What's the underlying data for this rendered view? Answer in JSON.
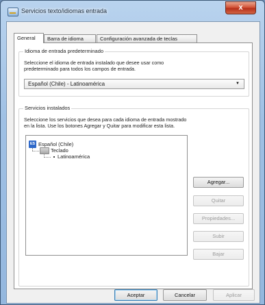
{
  "window": {
    "title": "Servicios texto/idiomas entrada",
    "close_symbol": "x"
  },
  "tabs": [
    {
      "label": "General",
      "active": true
    },
    {
      "label": "Barra de idioma",
      "active": false
    },
    {
      "label": "Configuración avanzada de teclas",
      "active": false
    }
  ],
  "default_language": {
    "group_label": "Idioma de entrada predeterminado",
    "description_line1": "Seleccione el idioma de entrada instalado que desee usar como",
    "description_line2": "predeterminado para todos los campos de entrada.",
    "selected_value": "Español (Chile) - Latinoamérica",
    "dropdown_symbol": "▼"
  },
  "installed_services": {
    "group_label": "Servicios instalados",
    "description_line1": "Seleccione los servicios que desea para cada idioma de entrada mostrado",
    "description_line2": "en la lista. Use los botones Agregar y Quitar para modificar esta lista.",
    "tree": {
      "language_badge": "ES",
      "language": "Español (Chile)",
      "category": "Teclado",
      "layout": "Latinoamérica"
    },
    "buttons": {
      "add": "Agregar...",
      "remove": "Quitar",
      "properties": "Propiedades...",
      "move_up": "Subir",
      "move_down": "Bajar"
    }
  },
  "footer": {
    "ok": "Aceptar",
    "cancel": "Cancelar",
    "apply": "Aplicar"
  },
  "colors": {
    "title_bar": "#9fc0e4",
    "close_button": "#c8412a",
    "language_badge": "#2f69c9",
    "default_button_border": "#3c7fb1"
  }
}
